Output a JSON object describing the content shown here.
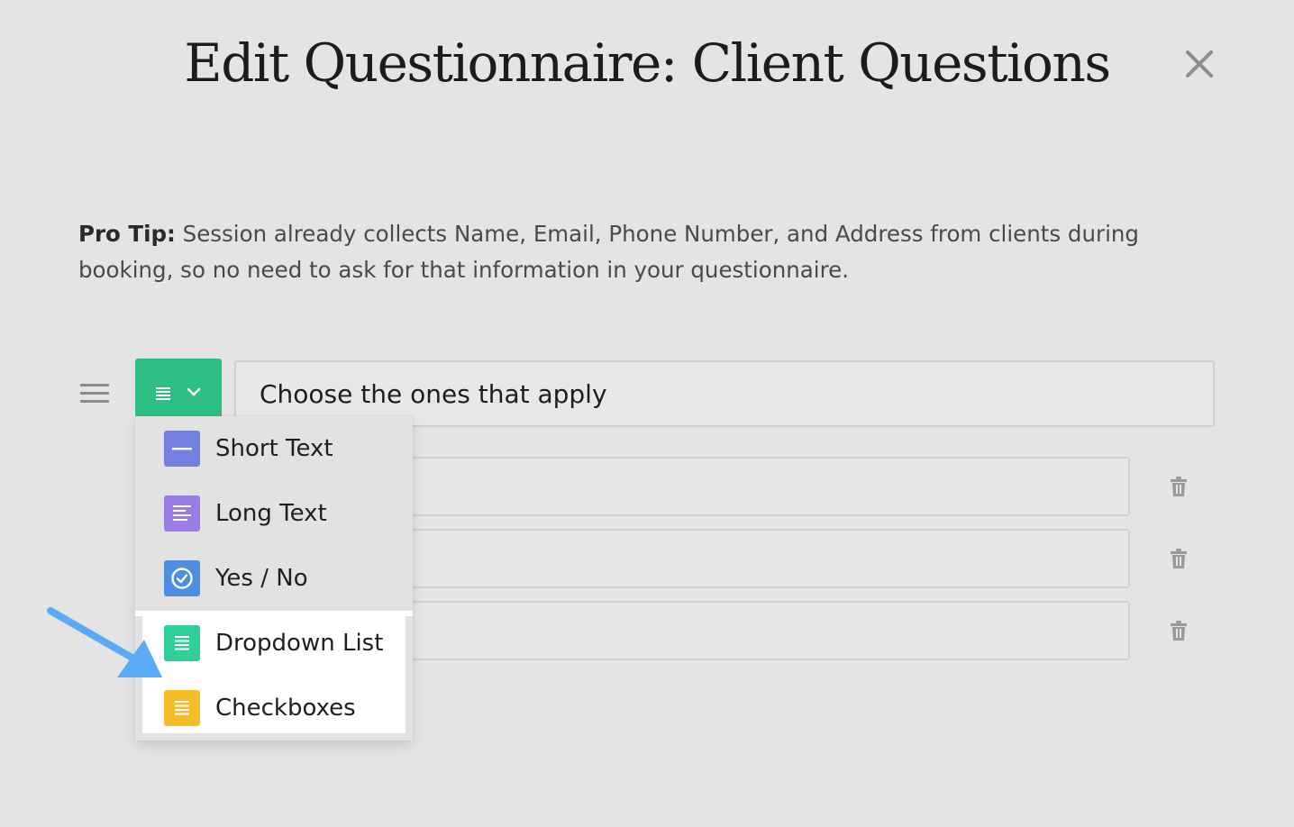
{
  "modal": {
    "title": "Edit Questionnaire: Client Questions",
    "close_icon": "close-icon"
  },
  "pro_tip": {
    "label": "Pro Tip:",
    "text": " Session already collects Name, Email, Phone Number, and Address from clients during booking, so no need to ask for that information in your questionnaire."
  },
  "question": {
    "value": "Choose the ones that apply",
    "type_icon": "list-icon",
    "type_color": "#2ebf85"
  },
  "option_rows": [
    {
      "value": ""
    },
    {
      "value": ""
    },
    {
      "value": ""
    }
  ],
  "type_menu": {
    "items": [
      {
        "label": "Short Text",
        "icon": "short-text-icon",
        "color": "#7480e0"
      },
      {
        "label": "Long Text",
        "icon": "long-text-icon",
        "color": "#9a7ce6"
      },
      {
        "label": "Yes / No",
        "icon": "check-circle-icon",
        "color": "#4c8fe0"
      },
      {
        "label": "Dropdown List",
        "icon": "list-icon",
        "color": "#2fcf97"
      },
      {
        "label": "Checkboxes",
        "icon": "list-icon",
        "color": "#f6bd28"
      }
    ]
  },
  "annotation": {
    "arrow_color": "#5aaaf5"
  }
}
